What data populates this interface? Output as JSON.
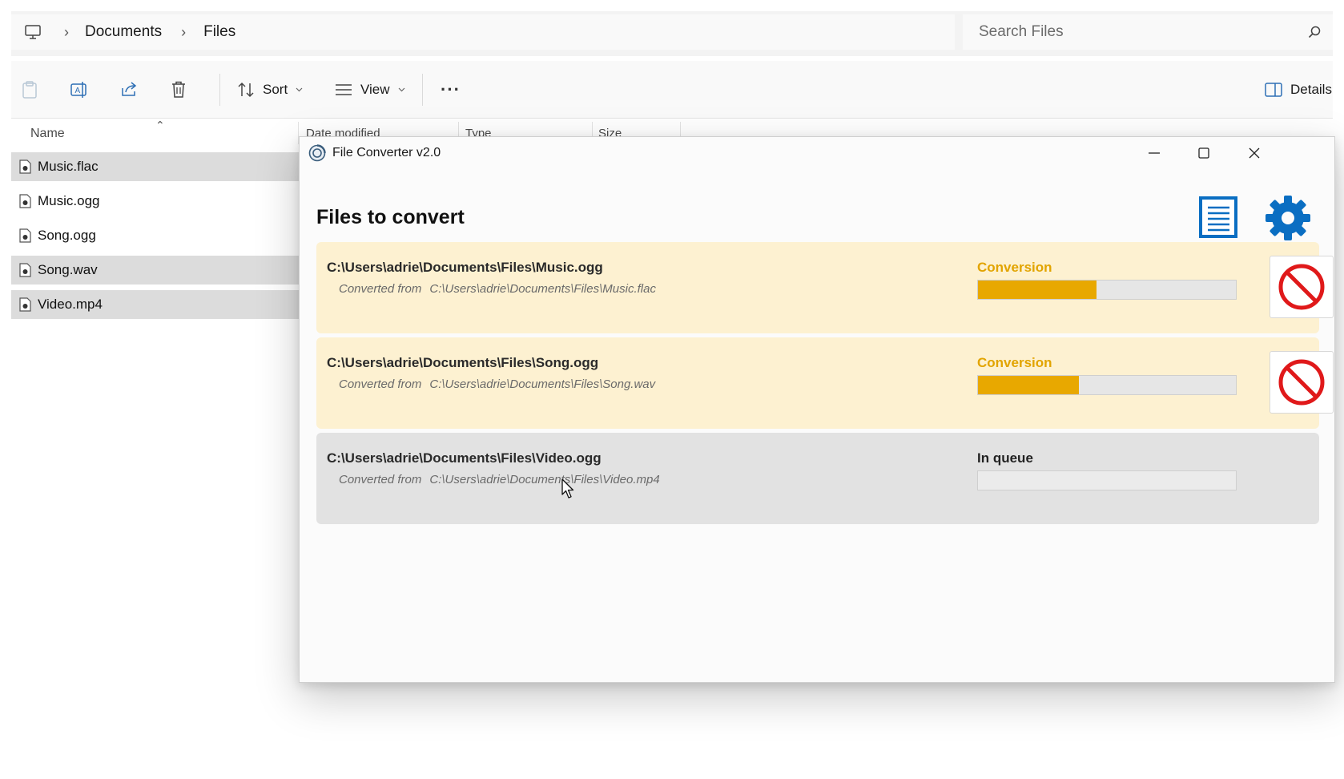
{
  "explorer": {
    "breadcrumb": [
      "Documents",
      "Files"
    ],
    "search": {
      "placeholder": "Search Files"
    },
    "toolbar": {
      "sort_label": "Sort",
      "view_label": "View",
      "more_label": "···",
      "details_label": "Details"
    },
    "columns": {
      "name": "Name",
      "date_modified": "Date modified",
      "type": "Type",
      "size": "Size"
    },
    "files": [
      {
        "name": "Music.flac",
        "selected": true
      },
      {
        "name": "Music.ogg",
        "selected": false
      },
      {
        "name": "Song.ogg",
        "selected": false
      },
      {
        "name": "Song.wav",
        "selected": true
      },
      {
        "name": "Video.mp4",
        "selected": true
      }
    ]
  },
  "converter": {
    "window_title": "File Converter v2.0",
    "heading": "Files to convert",
    "converted_from_label": "Converted from",
    "colors": {
      "accent": "#0a6ec2",
      "progress": "#e8a800",
      "active_card": "#fdf1d1",
      "queued_card": "#e2e2e2",
      "cancel": "#e0191a"
    },
    "jobs": [
      {
        "output": "C:\\Users\\adrie\\Documents\\Files\\Music.ogg",
        "source": "C:\\Users\\adrie\\Documents\\Files\\Music.flac",
        "status": "Conversion",
        "progress": 0.46
      },
      {
        "output": "C:\\Users\\adrie\\Documents\\Files\\Song.ogg",
        "source": "C:\\Users\\adrie\\Documents\\Files\\Song.wav",
        "status": "Conversion",
        "progress": 0.39
      },
      {
        "output": "C:\\Users\\adrie\\Documents\\Files\\Video.ogg",
        "source": "C:\\Users\\adrie\\Documents\\Files\\Video.mp4",
        "status": "In queue",
        "progress": 0
      }
    ]
  }
}
